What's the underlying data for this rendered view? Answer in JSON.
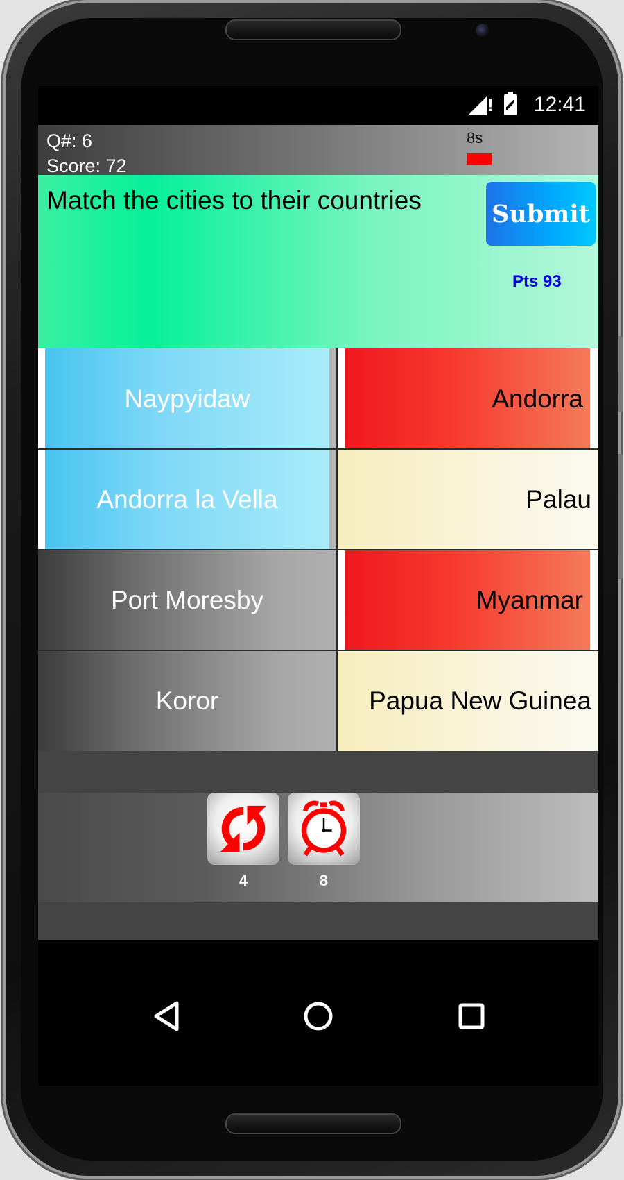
{
  "status_bar": {
    "time": "12:41",
    "icons": [
      "signal-icon",
      "battery-charging-icon"
    ]
  },
  "header": {
    "question_number": "Q#: 6",
    "score": "Score: 72",
    "timer": "8s",
    "timer_color": "#ff0000",
    "timer_level": 0.1
  },
  "question": {
    "prompt": "Match the cities to their countries",
    "submit_label": "Submit",
    "points": "Pts 93"
  },
  "matching": {
    "cities": [
      {
        "label": "Naypyidaw",
        "state": "selected"
      },
      {
        "label": "Andorra la Vella",
        "state": "selected"
      },
      {
        "label": "Port Moresby",
        "state": "default"
      },
      {
        "label": "Koror",
        "state": "default"
      }
    ],
    "countries": [
      {
        "label": "Andorra",
        "state": "wrong"
      },
      {
        "label": "Palau",
        "state": "default"
      },
      {
        "label": "Myanmar",
        "state": "wrong"
      },
      {
        "label": "Papua New Guinea",
        "state": "default"
      }
    ],
    "colors": {
      "selected": "#48c4f0",
      "wrong": "#f01820",
      "default_country": "#f7edbd"
    }
  },
  "powerups": [
    {
      "icon": "refresh-icon",
      "count": "4",
      "color": "#ff0000"
    },
    {
      "icon": "alarm-clock-icon",
      "count": "8",
      "color": "#ff0000"
    }
  ],
  "navigation": {
    "buttons": [
      "back-icon",
      "home-icon",
      "recents-icon"
    ]
  }
}
